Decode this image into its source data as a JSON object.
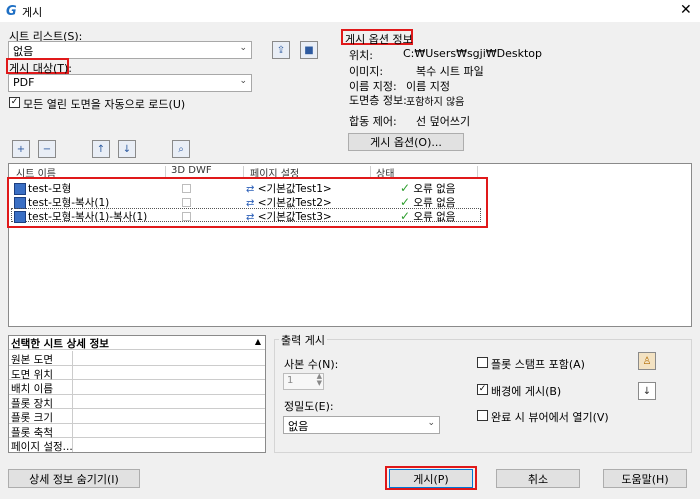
{
  "window": {
    "title": "게시",
    "close": "✕"
  },
  "sheet_list": {
    "label": "시트 리스트(S):",
    "value": "없음"
  },
  "publish_target": {
    "label": "게시 대상(T):",
    "value": "PDF"
  },
  "auto_load": {
    "label": "모든 열린 도면을 자동으로 로드(U)",
    "checked": true
  },
  "options_info": {
    "title": "게시 옵션 정보",
    "rows": [
      {
        "key": "위치:",
        "value": "C:₩Users₩sgji₩Desktop"
      },
      {
        "key": "이미지:",
        "value": "복수 시트 파일"
      },
      {
        "key": "이름 지정:",
        "value": "이름 지정"
      },
      {
        "key": "도면층 정보:",
        "value": "포함하지 않음"
      },
      {
        "key": "합동 제어:",
        "value": "선 덮어쓰기"
      }
    ],
    "button": "게시 옵션(O)..."
  },
  "table": {
    "columns": [
      "시트 이름",
      "3D DWF",
      "페이지 설정",
      "상태"
    ],
    "rows": [
      {
        "name": "test-모형",
        "page_setup": "<기본값Test1>",
        "status": "오류 없음"
      },
      {
        "name": "test-모형-복사(1)",
        "page_setup": "<기본값Test2>",
        "status": "오류 없음"
      },
      {
        "name": "test-모형-복사(1)-복사(1)",
        "page_setup": "<기본값Test3>",
        "status": "오류 없음"
      }
    ]
  },
  "detail": {
    "title": "선택한 시트 상세 정보",
    "rows": [
      "원본 도면",
      "도면 위치",
      "배치 이름",
      "플롯 장치",
      "플롯 크기",
      "플롯 축척",
      "페이지 설정..."
    ]
  },
  "output": {
    "title": "출력 게시",
    "copies_label": "사본 수(N):",
    "copies_value": "1",
    "precision_label": "정밀도(E):",
    "precision_value": "없음",
    "stamp": {
      "label": "플롯 스탬프 포함(A)",
      "checked": false
    },
    "background": {
      "label": "배경에 게시(B)",
      "checked": true
    },
    "open_viewer": {
      "label": "완료 시 뷰어에서 열기(V)",
      "checked": false
    }
  },
  "buttons": {
    "hide_details": "상세 정보 숨기기(I)",
    "publish": "게시(P)",
    "cancel": "취소",
    "help": "도움말(H)"
  },
  "colors": {
    "highlight": "#e0191a",
    "check": "#2e9e2e"
  }
}
